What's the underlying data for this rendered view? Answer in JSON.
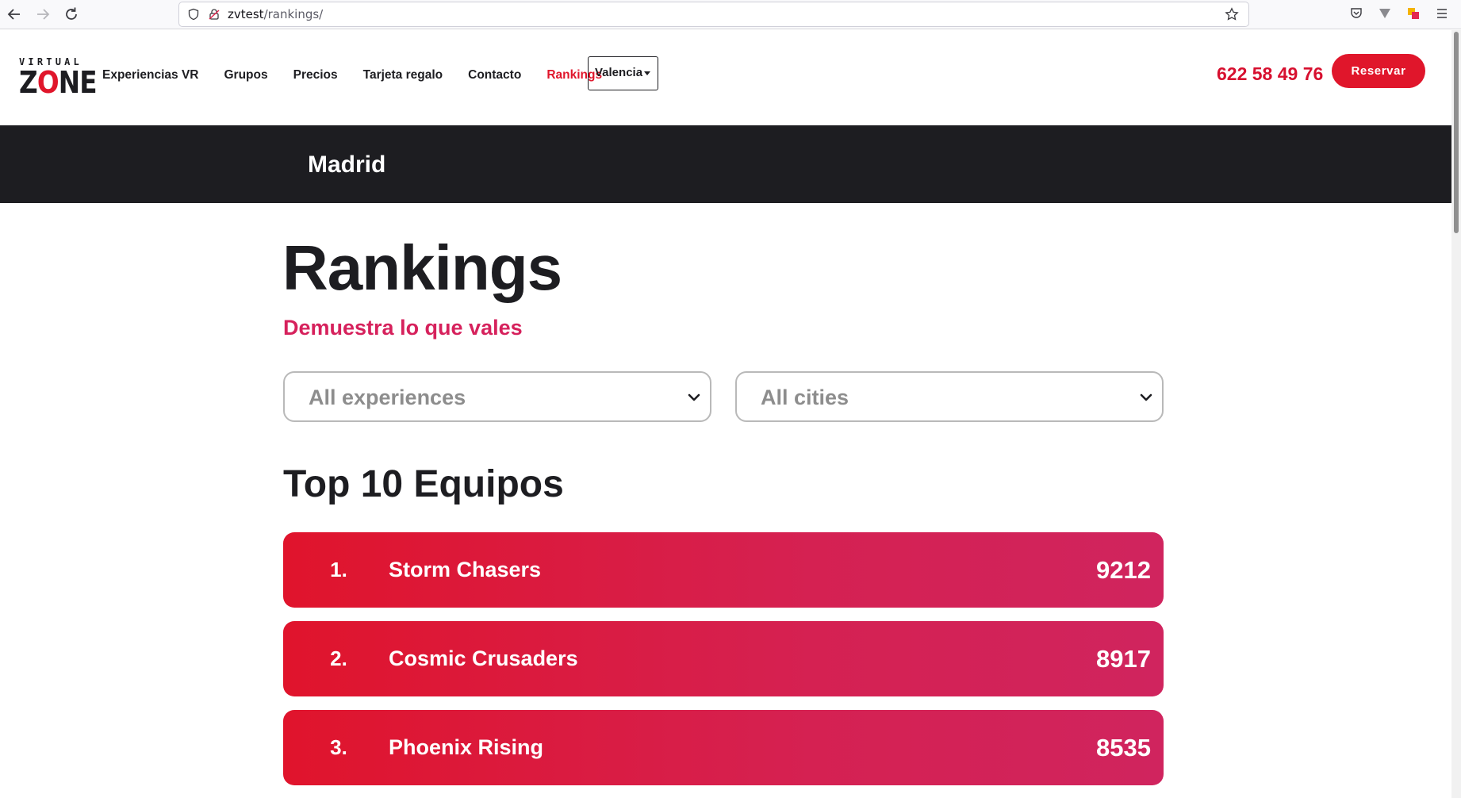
{
  "browser": {
    "url_host": "zvtest",
    "url_path": "/rankings/"
  },
  "header": {
    "logo_top": "VIRTUAL",
    "logo_bottom_z": "Z",
    "logo_bottom_o": "O",
    "logo_bottom_ne": "NE",
    "menu": [
      {
        "label": "Experiencias VR"
      },
      {
        "label": "Grupos"
      },
      {
        "label": "Precios"
      },
      {
        "label": "Tarjeta regalo"
      },
      {
        "label": "Contacto"
      },
      {
        "label": "Rankings",
        "active": true
      }
    ],
    "city_selector": "Valencia",
    "phone": "622 58 49 76",
    "reserve_label": "Reservar"
  },
  "banner": {
    "city": "Madrid"
  },
  "main": {
    "title": "Rankings",
    "subtitle": "Demuestra lo que vales",
    "filters": {
      "experience": "All experiences",
      "city": "All cities"
    },
    "section_title": "Top 10 Equipos",
    "rankings": [
      {
        "position": "1.",
        "team": "Storm Chasers",
        "score": "9212"
      },
      {
        "position": "2.",
        "team": "Cosmic Crusaders",
        "score": "8917"
      },
      {
        "position": "3.",
        "team": "Phoenix Rising",
        "score": "8535"
      }
    ]
  },
  "colors": {
    "brand_red": "#e0162b",
    "subtitle_pink": "#d6215c",
    "dark": "#1d1d21"
  }
}
